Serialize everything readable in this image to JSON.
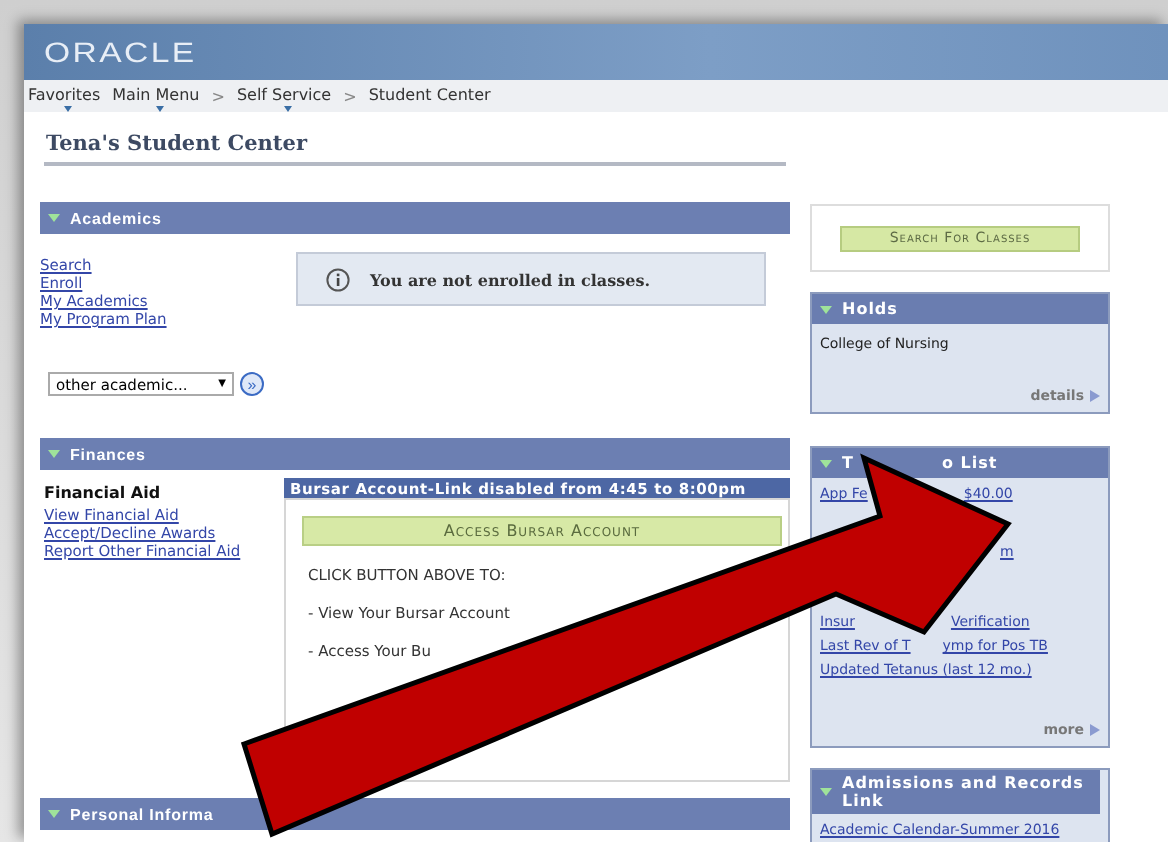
{
  "header": {
    "logo": "ORACLE"
  },
  "breadcrumbs": [
    {
      "label": "Favorites",
      "has_menu": true
    },
    {
      "label": "Main Menu",
      "has_menu": true
    },
    {
      "label": "Self Service",
      "has_menu": true,
      "separator_before": ">"
    },
    {
      "label": "Student Center",
      "has_menu": false,
      "separator_before": ">"
    }
  ],
  "page_title": "Tena's Student Center",
  "academics": {
    "title": "Academics",
    "expanded": true,
    "links": [
      "Search",
      "Enroll",
      "My Academics",
      "My Program Plan"
    ],
    "notice": "You are not enrolled in classes.",
    "dropdown": {
      "value": "other academic...",
      "arrow": "▼"
    },
    "go_button": "»"
  },
  "finances": {
    "title": "Finances",
    "expanded": true,
    "subtitle": "Financial Aid",
    "links": [
      "View Financial Aid",
      "Accept/Decline Awards",
      "Report Other Financial Aid"
    ],
    "bursar": {
      "title": "Bursar Account-Link disabled from 4:45 to 8:00pm",
      "button": "Access Bursar Account",
      "lines": [
        "CLICK BUTTON ABOVE TO:",
        "- View Your Bursar Account",
        "- Access Your Bu"
      ]
    }
  },
  "personal": {
    "title": "Personal Informa",
    "expanded": true
  },
  "search_button": "Search For Classes",
  "holds": {
    "title": "Holds",
    "expanded": true,
    "items": [
      "College of Nursing"
    ],
    "link": "details"
  },
  "todo": {
    "title_parts": [
      "T",
      "o List"
    ],
    "expanded": true,
    "items": [
      {
        "parts": [
          "App Fe",
          "$40.00"
        ]
      },
      {
        "parts": [
          "m"
        ]
      },
      {
        "parts": [
          "Insur",
          "Verification"
        ]
      },
      {
        "parts": [
          "Last Rev of T",
          "ymp for Pos TB"
        ]
      },
      {
        "parts": [
          "Updated Tetanus (last 12 mo.)"
        ]
      }
    ],
    "link": "more"
  },
  "admissions": {
    "title": "Admissions and Records Link",
    "expanded": true,
    "items": [
      "Academic Calendar-Summer 2016"
    ]
  },
  "annotation": {
    "kind": "arrow"
  }
}
